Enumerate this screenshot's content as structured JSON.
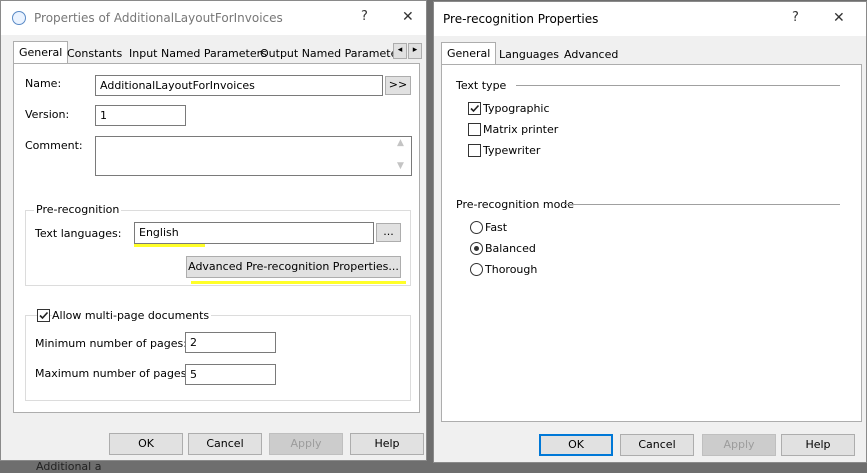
{
  "left_dialog": {
    "title": "Properties of AdditionalLayoutForInvoices",
    "help_glyph": "?",
    "close_glyph": "✕",
    "tabs": [
      "General",
      "Constants",
      "Input Named Parameters",
      "Output Named Parameters"
    ],
    "tab_scroll_left": "◂",
    "tab_scroll_right": "▸",
    "name_label": "Name:",
    "name_value": "AdditionalLayoutForInvoices",
    "name_more_button": ">>",
    "version_label": "Version:",
    "version_value": "1",
    "comment_label": "Comment:",
    "comment_value": "",
    "prerecog_group_title": "Pre-recognition",
    "text_languages_label": "Text languages:",
    "text_languages_value": "English",
    "languages_browse_button": "...",
    "advanced_button": "Advanced Pre-recognition Properties...",
    "multipage_checkbox_label": "Allow multi-page documents",
    "multipage_checked": true,
    "min_pages_label": "Minimum number of pages:",
    "min_pages_value": "2",
    "max_pages_label": "Maximum number of pages:",
    "max_pages_value": "5",
    "ok_button": "OK",
    "cancel_button": "Cancel",
    "apply_button": "Apply",
    "help_button": "Help"
  },
  "right_dialog": {
    "title": "Pre-recognition Properties",
    "help_glyph": "?",
    "close_glyph": "✕",
    "tabs": [
      "General",
      "Languages",
      "Advanced"
    ],
    "text_type_heading": "Text type",
    "text_types": [
      {
        "label": "Typographic",
        "checked": true
      },
      {
        "label": "Matrix printer",
        "checked": false
      },
      {
        "label": "Typewriter",
        "checked": false
      }
    ],
    "mode_heading": "Pre-recognition mode",
    "modes": [
      {
        "label": "Fast",
        "selected": false
      },
      {
        "label": "Balanced",
        "selected": true
      },
      {
        "label": "Thorough",
        "selected": false
      }
    ],
    "ok_button": "OK",
    "cancel_button": "Cancel",
    "apply_button": "Apply",
    "help_button": "Help"
  },
  "background_item_text": "Additional a",
  "colors": {
    "highlight": "#ffff29",
    "focus_border": "#0078d7",
    "dialog_bg": "#f0f0f0"
  }
}
